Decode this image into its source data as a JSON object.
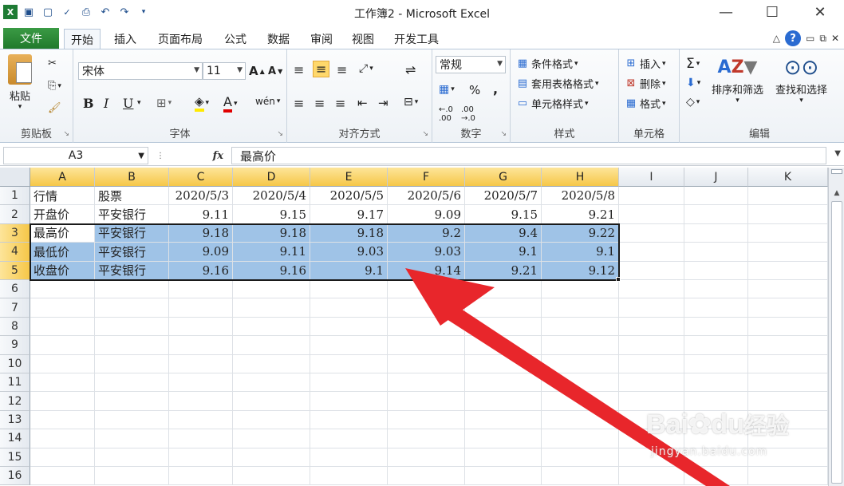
{
  "window": {
    "title": "工作簿2 - Microsoft Excel",
    "minimize": "—",
    "maximize": "☐",
    "close": "✕"
  },
  "tabs": {
    "file": "文件",
    "items": [
      "开始",
      "插入",
      "页面布局",
      "公式",
      "数据",
      "审阅",
      "视图",
      "开发工具"
    ]
  },
  "ribbon": {
    "clipboard": {
      "paste": "粘贴",
      "label": "剪贴板"
    },
    "font": {
      "name": "宋体",
      "size": "11",
      "bold": "B",
      "italic": "I",
      "underline": "U",
      "grow": "A",
      "shrink": "A",
      "phonetic": "wén",
      "color_a": "A",
      "label": "字体"
    },
    "alignment": {
      "label": "对齐方式"
    },
    "number": {
      "format": "常规",
      "percent": "%",
      "comma": ",",
      "label": "数字"
    },
    "styles": {
      "conditional": "条件格式",
      "table": "套用表格格式",
      "cell": "单元格样式",
      "label": "样式"
    },
    "cells": {
      "insert": "插入",
      "delete": "删除",
      "format": "格式",
      "label": "单元格"
    },
    "editing": {
      "sigma": "Σ",
      "sort": "排序和筛选",
      "find": "查找和选择",
      "label": "编辑"
    }
  },
  "formula_bar": {
    "name_box": "A3",
    "fx": "fx",
    "value": "最高价"
  },
  "sheet": {
    "columns": [
      "A",
      "B",
      "C",
      "D",
      "E",
      "F",
      "G",
      "H",
      "I",
      "J",
      "K"
    ],
    "rows": [
      "1",
      "2",
      "3",
      "4",
      "5",
      "6",
      "7",
      "8",
      "9",
      "10",
      "11",
      "12",
      "13",
      "14",
      "15",
      "16"
    ],
    "data": [
      [
        "行情",
        "股票",
        "2020/5/3",
        "2020/5/4",
        "2020/5/5",
        "2020/5/6",
        "2020/5/7",
        "2020/5/8"
      ],
      [
        "开盘价",
        "平安银行",
        "9.11",
        "9.15",
        "9.17",
        "9.09",
        "9.15",
        "9.21"
      ],
      [
        "最高价",
        "平安银行",
        "9.18",
        "9.18",
        "9.18",
        "9.2",
        "9.4",
        "9.22"
      ],
      [
        "最低价",
        "平安银行",
        "9.09",
        "9.11",
        "9.03",
        "9.03",
        "9.1",
        "9.1"
      ],
      [
        "收盘价",
        "平安银行",
        "9.16",
        "9.16",
        "9.1",
        "9.14",
        "9.21",
        "9.12"
      ]
    ],
    "selection": "A3:H5",
    "highlight_color": "#9fc3e7",
    "selected_header_color": "#f6c748"
  },
  "watermark": {
    "brand": "Bai",
    "brand2": "du",
    "text": "经验",
    "url": "jingyan.baidu.com"
  },
  "colors": {
    "file_tab": "#217a2c",
    "arrow": "#e8262b"
  }
}
